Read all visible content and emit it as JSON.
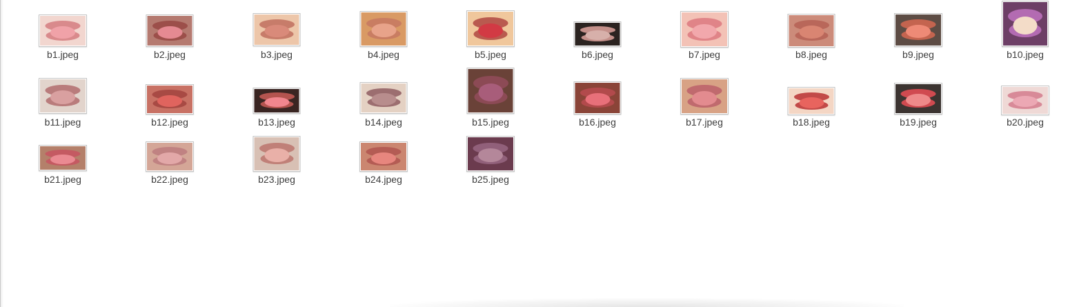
{
  "files": [
    {
      "name": "b1.jpeg",
      "bg": "#f2d6cf",
      "tongue": "#f0a2a8",
      "lip": "#d98a8c"
    },
    {
      "name": "b2.jpeg",
      "bg": "#b57a70",
      "tongue": "#e58a92",
      "lip": "#9c4f4a"
    },
    {
      "name": "b3.jpeg",
      "bg": "#edc6a9",
      "tongue": "#d98a7a",
      "lip": "#c77c6a"
    },
    {
      "name": "b4.jpeg",
      "bg": "#d99a64",
      "tongue": "#e8a38a",
      "lip": "#c97d62"
    },
    {
      "name": "b5.jpeg",
      "bg": "#f0c79c",
      "tongue": "#d23a44",
      "lip": "#b95a4f"
    },
    {
      "name": "b6.jpeg",
      "bg": "#2b2320",
      "tongue": "#d7b0aa",
      "lip": "#c4908a"
    },
    {
      "name": "b7.jpeg",
      "bg": "#f3c2b6",
      "tongue": "#f2a8ac",
      "lip": "#e08488"
    },
    {
      "name": "b8.jpeg",
      "bg": "#cc8b7a",
      "tongue": "#d98572",
      "lip": "#b9675a"
    },
    {
      "name": "b9.jpeg",
      "bg": "#5d4c44",
      "tongue": "#ee8a76",
      "lip": "#c4644f"
    },
    {
      "name": "b10.jpeg",
      "bg": "#6d3f66",
      "tongue": "#f3dcc8",
      "lip": "#b36bb2"
    },
    {
      "name": "b11.jpeg",
      "bg": "#e2d4cc",
      "tongue": "#d9a0a0",
      "lip": "#b97c7c"
    },
    {
      "name": "b12.jpeg",
      "bg": "#c87164",
      "tongue": "#e0645e",
      "lip": "#a84a44"
    },
    {
      "name": "b13.jpeg",
      "bg": "#3a2522",
      "tongue": "#f1868e",
      "lip": "#b4544f"
    },
    {
      "name": "b14.jpeg",
      "bg": "#e4d1c3",
      "tongue": "#b88d8d",
      "lip": "#9c6e70"
    },
    {
      "name": "b15.jpeg",
      "bg": "#6a4238",
      "tongue": "#a85d7a",
      "lip": "#8c4a55"
    },
    {
      "name": "b16.jpeg",
      "bg": "#8a4438",
      "tongue": "#e8707a",
      "lip": "#b24a4c"
    },
    {
      "name": "b17.jpeg",
      "bg": "#d8a285",
      "tongue": "#e38b8f",
      "lip": "#c06a6e"
    },
    {
      "name": "b18.jpeg",
      "bg": "#f4d6c4",
      "tongue": "#e8645e",
      "lip": "#c24a48"
    },
    {
      "name": "b19.jpeg",
      "bg": "#3c3431",
      "tongue": "#ee8a8a",
      "lip": "#d04a50"
    },
    {
      "name": "b20.jpeg",
      "bg": "#efd9d6",
      "tongue": "#eca8b4",
      "lip": "#d88a98"
    },
    {
      "name": "b21.jpeg",
      "bg": "#b4806a",
      "tongue": "#ea8a92",
      "lip": "#c45a62"
    },
    {
      "name": "b22.jpeg",
      "bg": "#d4a697",
      "tongue": "#e2a8a8",
      "lip": "#c08282"
    },
    {
      "name": "b23.jpeg",
      "bg": "#d8c0b4",
      "tongue": "#e9b0a8",
      "lip": "#c08078"
    },
    {
      "name": "b24.jpeg",
      "bg": "#cb8670",
      "tongue": "#e7867e",
      "lip": "#b45c54"
    },
    {
      "name": "b25.jpeg",
      "bg": "#6b3b4e",
      "tongue": "#b4879a",
      "lip": "#91607a"
    }
  ]
}
